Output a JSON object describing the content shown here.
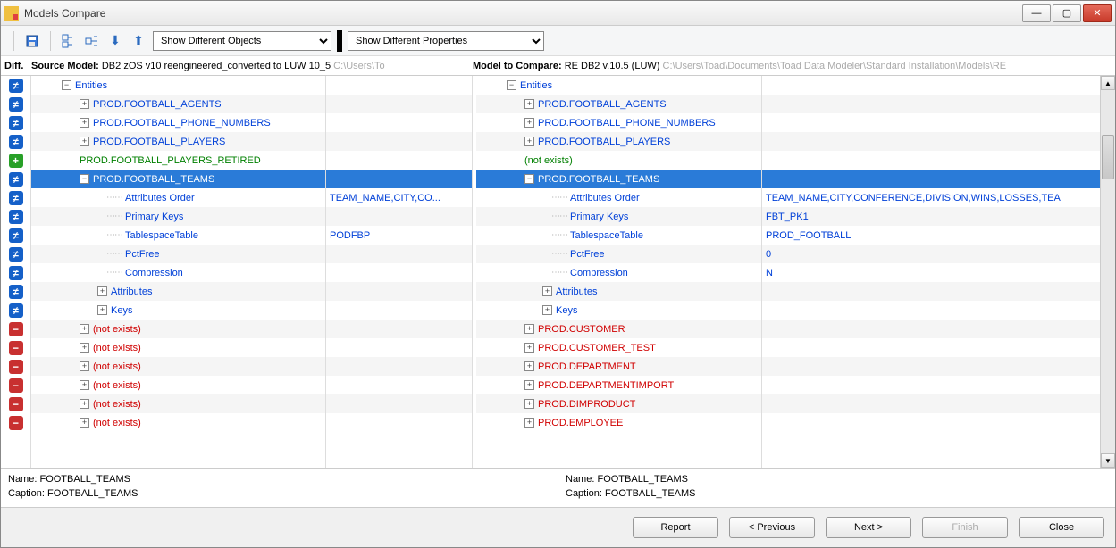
{
  "title": "Models Compare",
  "toolbar": {
    "dropdown1": "Show Different Objects",
    "dropdown2": "Show Different Properties"
  },
  "headers": {
    "diff_label": "Diff.",
    "source_label": "Source Model:",
    "source_value": "DB2 zOS v10 reengineered_converted to LUW 10_5",
    "source_path": "C:\\Users\\To",
    "compare_label": "Model to Compare:",
    "compare_value": "RE DB2 v.10.5 (LUW)",
    "compare_path": "C:\\Users\\Toad\\Documents\\Toad Data Modeler\\Standard Installation\\Models\\RE"
  },
  "rows": [
    {
      "diff": "neq",
      "l_indent": 30,
      "l_toggle": "-",
      "l_text": "Entities",
      "l_cls": "blue",
      "r_indent": 30,
      "r_toggle": "-",
      "r_text": "Entities",
      "r_cls": "blue",
      "l_val": "",
      "r_val": ""
    },
    {
      "diff": "neq",
      "alt": true,
      "l_indent": 50,
      "l_toggle": "+",
      "l_text": "PROD.FOOTBALL_AGENTS",
      "l_cls": "blue",
      "r_indent": 50,
      "r_toggle": "+",
      "r_text": "PROD.FOOTBALL_AGENTS",
      "r_cls": "blue",
      "l_val": "",
      "r_val": ""
    },
    {
      "diff": "neq",
      "l_indent": 50,
      "l_toggle": "+",
      "l_text": "PROD.FOOTBALL_PHONE_NUMBERS",
      "l_cls": "blue",
      "r_indent": 50,
      "r_toggle": "+",
      "r_text": "PROD.FOOTBALL_PHONE_NUMBERS",
      "r_cls": "blue",
      "l_val": "",
      "r_val": ""
    },
    {
      "diff": "neq",
      "alt": true,
      "l_indent": 50,
      "l_toggle": "+",
      "l_text": "PROD.FOOTBALL_PLAYERS",
      "l_cls": "blue",
      "r_indent": 50,
      "r_toggle": "+",
      "r_text": "PROD.FOOTBALL_PLAYERS",
      "r_cls": "blue",
      "l_val": "",
      "r_val": ""
    },
    {
      "diff": "plus",
      "l_indent": 50,
      "l_toggle": "",
      "l_text": "PROD.FOOTBALL_PLAYERS_RETIRED",
      "l_cls": "green",
      "r_indent": 50,
      "r_toggle": "",
      "r_text": "(not exists)",
      "r_cls": "green",
      "l_val": "",
      "r_val": ""
    },
    {
      "diff": "neq",
      "sel": true,
      "l_indent": 50,
      "l_toggle": "-",
      "l_text": "PROD.FOOTBALL_TEAMS",
      "r_indent": 50,
      "r_toggle": "-",
      "r_text": "PROD.FOOTBALL_TEAMS",
      "l_val": "",
      "r_val": ""
    },
    {
      "diff": "neq",
      "l_indent": 80,
      "l_dots": true,
      "l_text": "Attributes Order",
      "l_cls": "blue",
      "r_indent": 80,
      "r_dots": true,
      "r_text": "Attributes Order",
      "r_cls": "blue",
      "l_val": "TEAM_NAME,CITY,CO...",
      "vcls": "blue",
      "r_val": "TEAM_NAME,CITY,CONFERENCE,DIVISION,WINS,LOSSES,TEA"
    },
    {
      "diff": "neq",
      "alt": true,
      "l_indent": 80,
      "l_dots": true,
      "l_text": "Primary Keys",
      "l_cls": "blue",
      "r_indent": 80,
      "r_dots": true,
      "r_text": "Primary Keys",
      "r_cls": "blue",
      "l_val": "",
      "r_val": "FBT_PK1",
      "vcls": "blue"
    },
    {
      "diff": "neq",
      "l_indent": 80,
      "l_dots": true,
      "l_text": "TablespaceTable",
      "l_cls": "blue",
      "r_indent": 80,
      "r_dots": true,
      "r_text": "TablespaceTable",
      "r_cls": "blue",
      "l_val": "PODFBP",
      "vcls": "blue",
      "r_val": "PROD_FOOTBALL"
    },
    {
      "diff": "neq",
      "alt": true,
      "l_indent": 80,
      "l_dots": true,
      "l_text": "PctFree",
      "l_cls": "blue",
      "r_indent": 80,
      "r_dots": true,
      "r_text": "PctFree",
      "r_cls": "blue",
      "l_val": "",
      "r_val": "0",
      "vcls": "blue"
    },
    {
      "diff": "neq",
      "l_indent": 80,
      "l_dots": true,
      "l_text": "Compression",
      "l_cls": "blue",
      "r_indent": 80,
      "r_dots": true,
      "r_text": "Compression",
      "r_cls": "blue",
      "l_val": "",
      "r_val": "N",
      "vcls": "blue"
    },
    {
      "diff": "neq",
      "alt": true,
      "l_indent": 70,
      "l_toggle": "+",
      "l_text": "Attributes",
      "l_cls": "blue",
      "r_indent": 70,
      "r_toggle": "+",
      "r_text": "Attributes",
      "r_cls": "blue",
      "l_val": "",
      "r_val": ""
    },
    {
      "diff": "neq",
      "l_indent": 70,
      "l_toggle": "+",
      "l_text": "Keys",
      "l_cls": "blue",
      "r_indent": 70,
      "r_toggle": "+",
      "r_text": "Keys",
      "r_cls": "blue",
      "l_val": "",
      "r_val": ""
    },
    {
      "diff": "minus",
      "alt": true,
      "l_indent": 50,
      "l_toggle": "+",
      "l_text": "(not exists)",
      "l_cls": "red",
      "r_indent": 50,
      "r_toggle": "+",
      "r_text": "PROD.CUSTOMER",
      "r_cls": "red",
      "l_val": "",
      "r_val": ""
    },
    {
      "diff": "minus",
      "l_indent": 50,
      "l_toggle": "+",
      "l_text": "(not exists)",
      "l_cls": "red",
      "r_indent": 50,
      "r_toggle": "+",
      "r_text": "PROD.CUSTOMER_TEST",
      "r_cls": "red",
      "l_val": "",
      "r_val": ""
    },
    {
      "diff": "minus",
      "alt": true,
      "l_indent": 50,
      "l_toggle": "+",
      "l_text": "(not exists)",
      "l_cls": "red",
      "r_indent": 50,
      "r_toggle": "+",
      "r_text": "PROD.DEPARTMENT",
      "r_cls": "red",
      "l_val": "",
      "r_val": ""
    },
    {
      "diff": "minus",
      "l_indent": 50,
      "l_toggle": "+",
      "l_text": "(not exists)",
      "l_cls": "red",
      "r_indent": 50,
      "r_toggle": "+",
      "r_text": "PROD.DEPARTMENTIMPORT",
      "r_cls": "red",
      "l_val": "",
      "r_val": ""
    },
    {
      "diff": "minus",
      "alt": true,
      "l_indent": 50,
      "l_toggle": "+",
      "l_text": "(not exists)",
      "l_cls": "red",
      "r_indent": 50,
      "r_toggle": "+",
      "r_text": "PROD.DIMPRODUCT",
      "r_cls": "red",
      "l_val": "",
      "r_val": ""
    },
    {
      "diff": "minus",
      "l_indent": 50,
      "l_toggle": "+",
      "l_text": "(not exists)",
      "l_cls": "red",
      "r_indent": 50,
      "r_toggle": "+",
      "r_text": "PROD.EMPLOYEE",
      "r_cls": "red",
      "l_val": "",
      "r_val": ""
    }
  ],
  "footer": {
    "left_name_label": "Name:",
    "left_name": "FOOTBALL_TEAMS",
    "left_caption_label": "Caption:",
    "left_caption": "FOOTBALL_TEAMS",
    "right_name_label": "Name:",
    "right_name": "FOOTBALL_TEAMS",
    "right_caption_label": "Caption:",
    "right_caption": "FOOTBALL_TEAMS"
  },
  "buttons": {
    "report": "Report",
    "previous": "< Previous",
    "next": "Next >",
    "finish": "Finish",
    "close": "Close"
  }
}
